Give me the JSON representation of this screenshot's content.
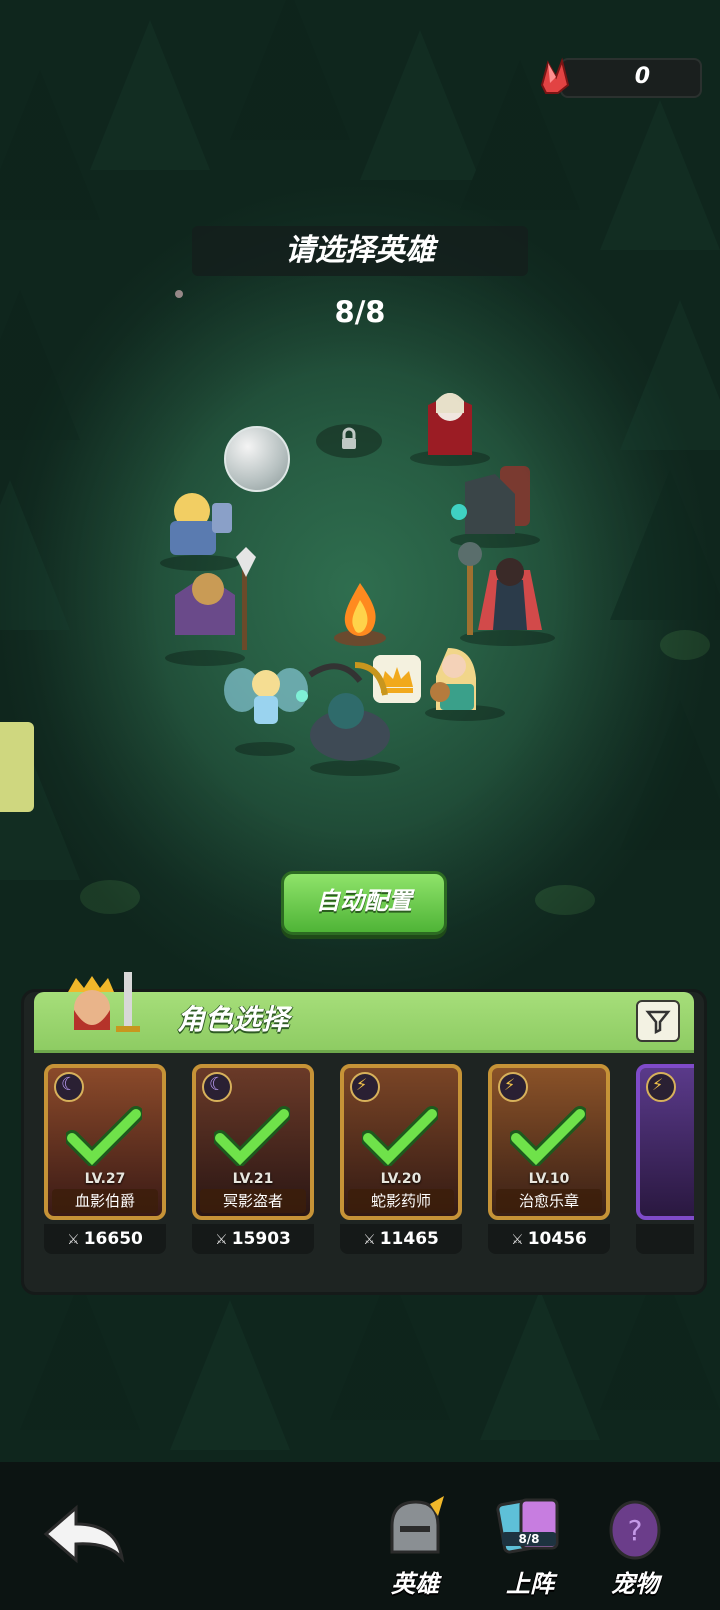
{
  "currency": {
    "value": "0",
    "icon": "red-crystal-icon"
  },
  "header": {
    "title": "请选择英雄",
    "count": "8/8"
  },
  "auto_button": {
    "label": "自动配置"
  },
  "panel": {
    "title": "角色选择",
    "cards": [
      {
        "level": "LV.27",
        "name": "血影伯爵",
        "power": "16650",
        "element": "moon",
        "selected": true
      },
      {
        "level": "LV.21",
        "name": "冥影盗者",
        "power": "15903",
        "element": "moon",
        "selected": true
      },
      {
        "level": "LV.20",
        "name": "蛇影药师",
        "power": "11465",
        "element": "lightning",
        "selected": true
      },
      {
        "level": "LV.10",
        "name": "治愈乐章",
        "power": "10456",
        "element": "lightning",
        "selected": true
      }
    ]
  },
  "bottom_nav": {
    "items": [
      {
        "label": "英雄",
        "icon": "knight-helmet-icon"
      },
      {
        "label": "上阵",
        "icon": "formation-cards-icon",
        "badge": "8/8"
      },
      {
        "label": "宠物",
        "icon": "pet-egg-icon"
      }
    ]
  },
  "colors": {
    "accent_green": "#8ecc63",
    "card_gold": "#c69337",
    "card_purple": "#7f4bc9"
  }
}
